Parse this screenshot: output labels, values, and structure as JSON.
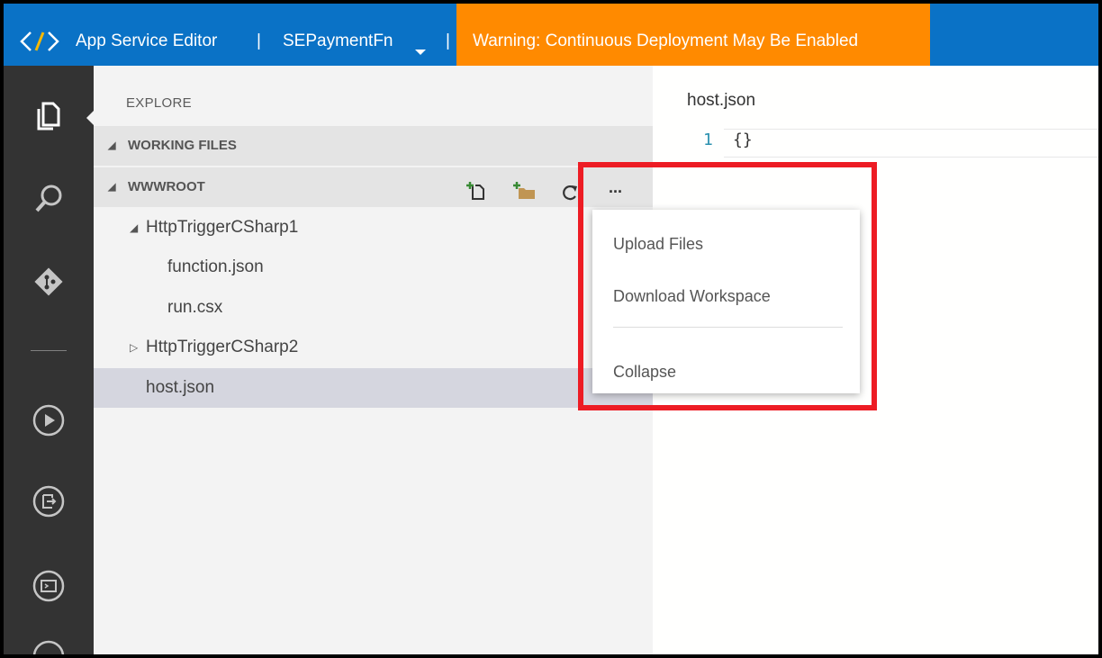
{
  "titlebar": {
    "app_title": "App Service Editor",
    "separator": "|",
    "site_name": "SEPaymentFn",
    "warning": "Warning: Continuous Deployment May Be Enabled",
    "colors": {
      "bar": "#0a72c6",
      "warning": "#ff8a00"
    }
  },
  "activity_bar": {
    "icons": [
      "explorer-icon",
      "search-icon",
      "git-icon",
      "run-icon",
      "output-icon",
      "console-icon"
    ]
  },
  "sidebar": {
    "title": "EXPLORE",
    "sections": {
      "working_files": "WORKING FILES",
      "wwwroot": "WWWROOT"
    },
    "tree": {
      "folder1": "HttpTriggerCSharp1",
      "file1": "function.json",
      "file2": "run.csx",
      "folder2": "HttpTriggerCSharp2",
      "file3": "host.json"
    },
    "toolbar": {
      "more_label": "..."
    }
  },
  "editor": {
    "tab": "host.json",
    "line_number": "1",
    "code": "{}"
  },
  "context_menu": {
    "upload": "Upload Files",
    "download": "Download Workspace",
    "collapse": "Collapse"
  },
  "highlight_color": "#ed1c24"
}
